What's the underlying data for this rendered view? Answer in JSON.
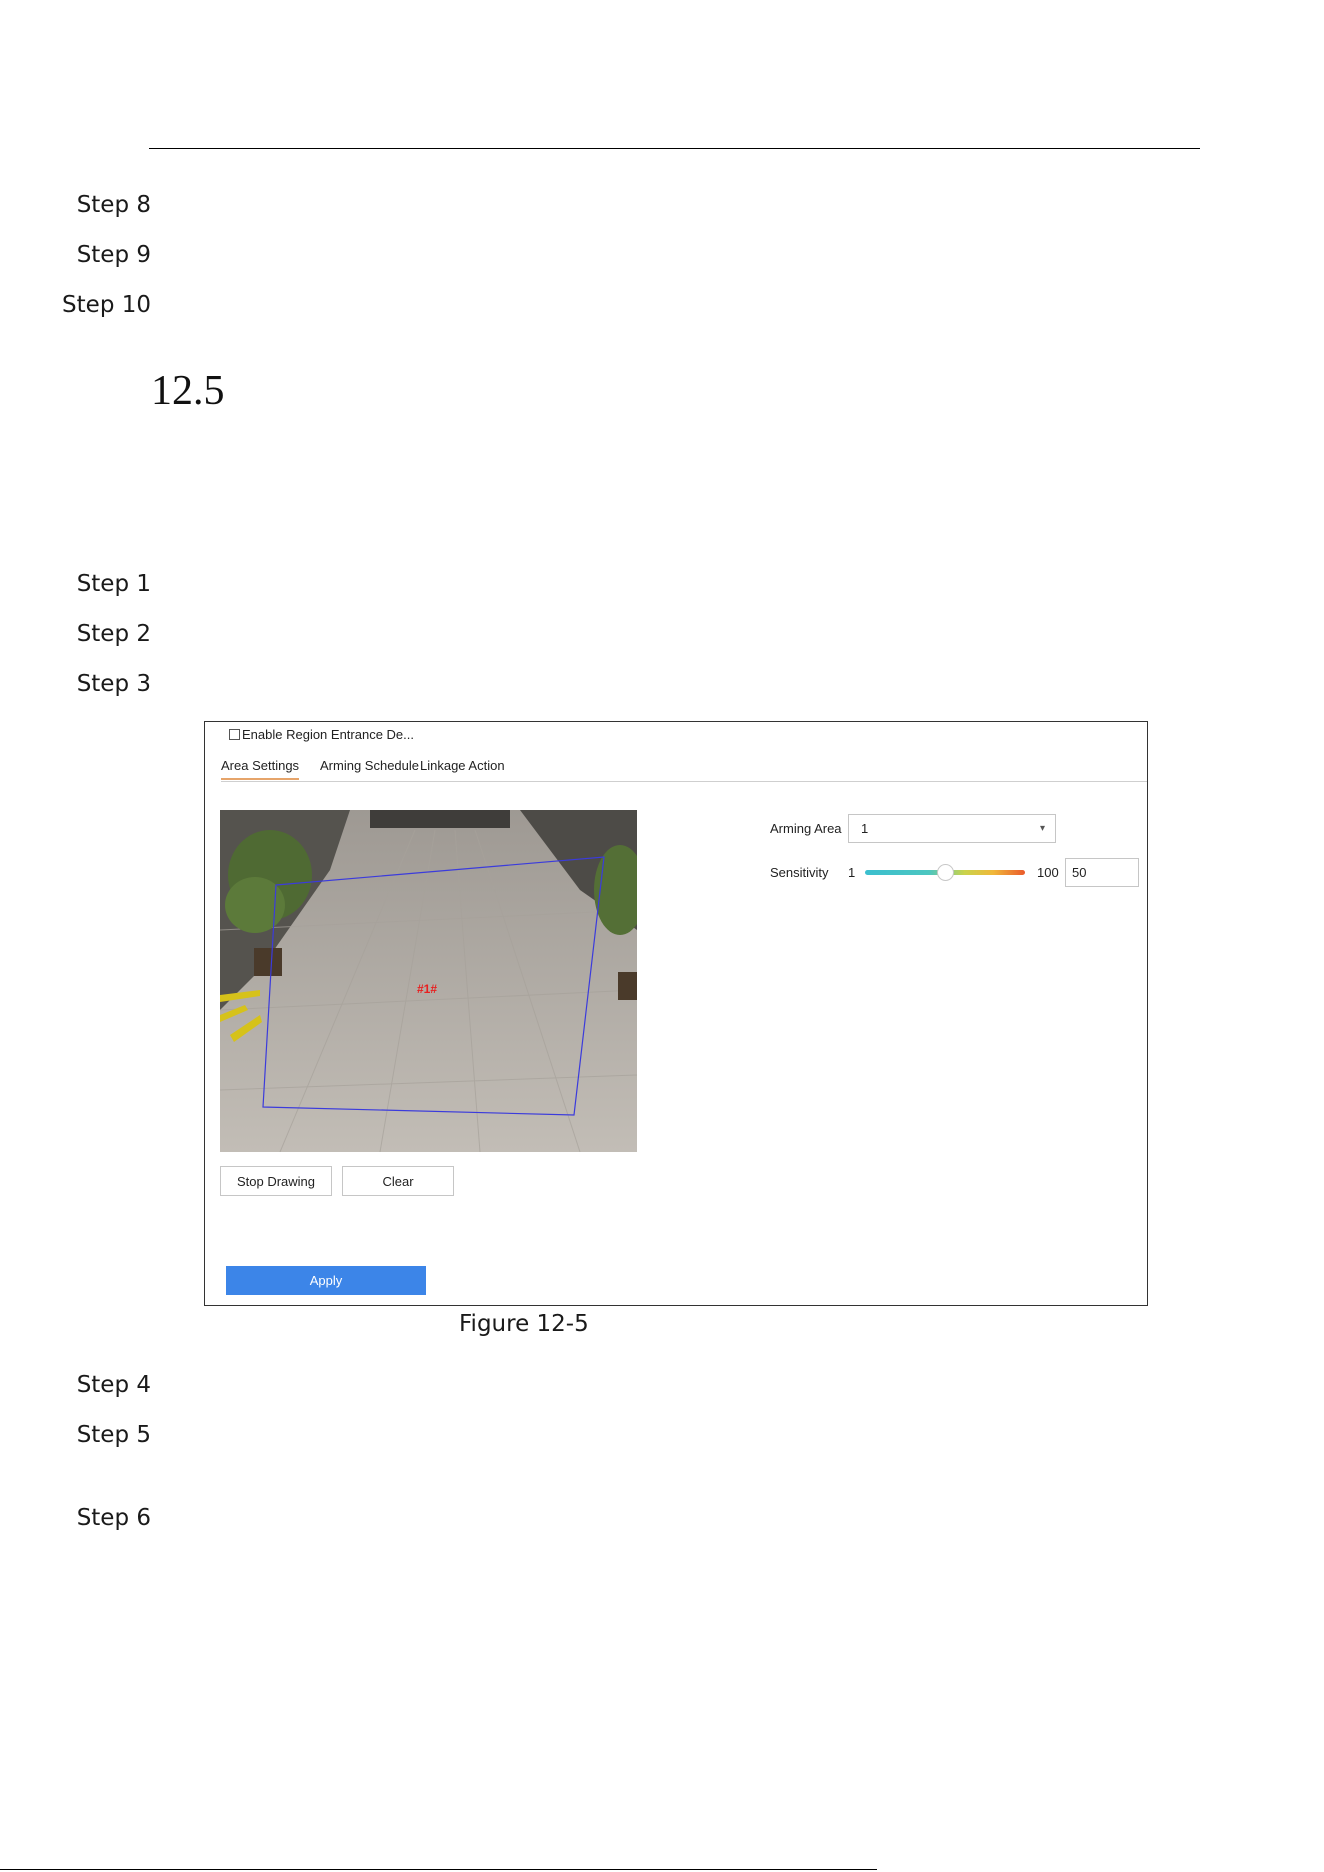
{
  "steps_top": [
    "Step 8",
    "Step 9",
    "Step 10"
  ],
  "section": {
    "number": "12.5"
  },
  "steps_mid": [
    "Step 1",
    "Step 2",
    "Step 3"
  ],
  "figure": {
    "enable_label": "Enable Region Entrance De...",
    "tabs": [
      "Area Settings",
      "Arming Schedule",
      "Linkage Action"
    ],
    "region_label": "#1#",
    "stop_drawing_label": "Stop Drawing",
    "clear_label": "Clear",
    "apply_label": "Apply",
    "arming_area_label": "Arming Area",
    "arming_area_value": "1",
    "sensitivity_label": "Sensitivity",
    "sensitivity_min": "1",
    "sensitivity_max": "100",
    "sensitivity_value": "50",
    "sensitivity_fraction": 0.5,
    "colors": {
      "accent": "#3c85e8",
      "tab_underline": "#e6a46a",
      "region_line": "#3b3bdc",
      "region_label": "#e82020"
    }
  },
  "caption": "Figure 12-5",
  "steps_bottom": [
    "Step 4",
    "Step 5",
    "Step 6"
  ]
}
